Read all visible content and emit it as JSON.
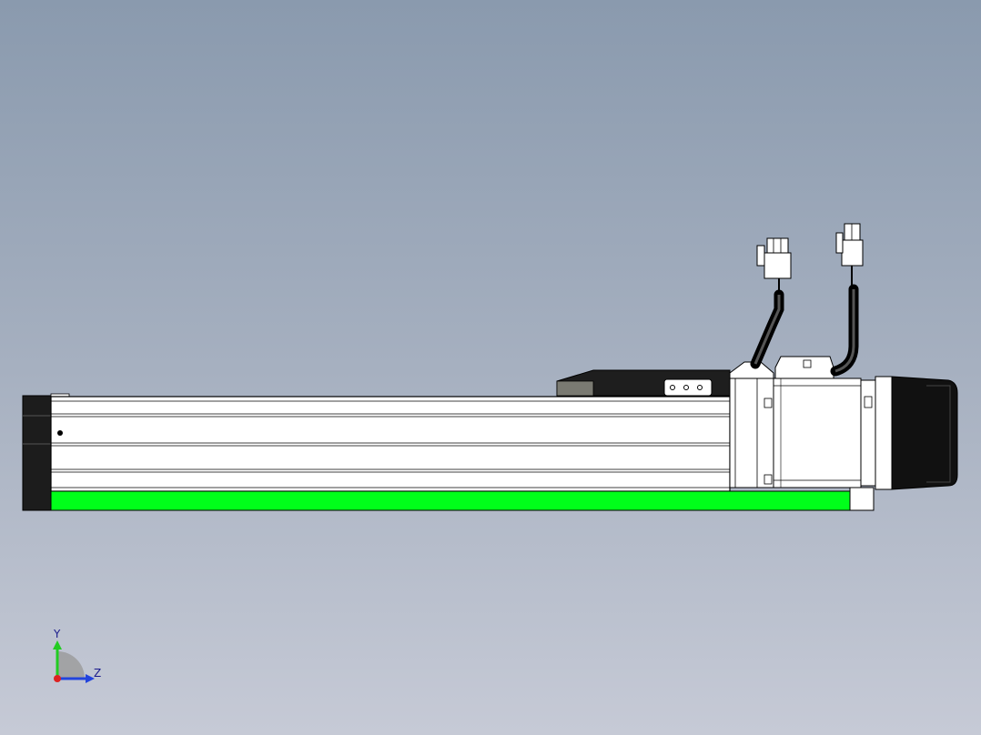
{
  "viewport": {
    "background_top": "#8a9aae",
    "background_bottom": "#c6cad6"
  },
  "model": {
    "highlight_color": "#00ff1a",
    "body_color": "#ffffff",
    "outline_color": "#000000",
    "motor_cover_color": "#111111",
    "carriage_color": "#1e1e1e"
  },
  "triad": {
    "y_label": "Y",
    "z_label": "Z",
    "y_color": "#22cc22",
    "z_color": "#2244dd",
    "x_color": "#dd2222"
  }
}
